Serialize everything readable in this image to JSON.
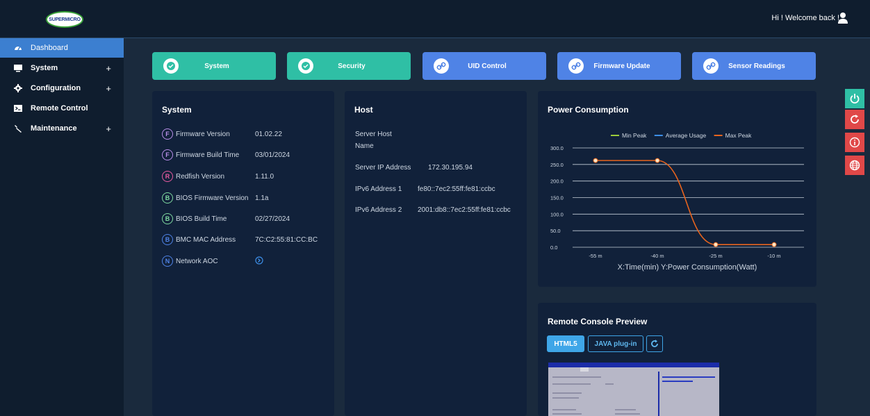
{
  "header": {
    "logo_text": "SUPERMICRO",
    "welcome": "Hi ! Welcome back !"
  },
  "sidebar": {
    "items": [
      {
        "label": "Dashboard",
        "icon": "dashboard-icon",
        "expandable": false,
        "active": true
      },
      {
        "label": "System",
        "icon": "monitor-icon",
        "expandable": true
      },
      {
        "label": "Configuration",
        "icon": "gear-icon",
        "expandable": true
      },
      {
        "label": "Remote Control",
        "icon": "terminal-icon",
        "expandable": false
      },
      {
        "label": "Maintenance",
        "icon": "wrench-icon",
        "expandable": true
      }
    ],
    "plus": "+"
  },
  "quick": [
    {
      "label": "System",
      "color": "#2fbfa5",
      "icon": "status-ok-icon"
    },
    {
      "label": "Security",
      "color": "#2fbfa5",
      "icon": "status-ok-icon"
    },
    {
      "label": "UID Control",
      "color": "#4f83e6",
      "icon": "link-icon"
    },
    {
      "label": "Firmware Update",
      "color": "#4f83e6",
      "icon": "link-icon"
    },
    {
      "label": "Sensor Readings",
      "color": "#4f83e6",
      "icon": "link-icon"
    }
  ],
  "system": {
    "title": "System",
    "rows": [
      {
        "badge": "F",
        "color": "#b98ee8",
        "label": "Firmware Version",
        "value": "01.02.22"
      },
      {
        "badge": "F",
        "color": "#b98ee8",
        "label": "Firmware Build Time",
        "value": "03/01/2024"
      },
      {
        "badge": "R",
        "color": "#e85aa0",
        "label": "Redfish Version",
        "value": "1.11.0"
      },
      {
        "badge": "B",
        "color": "#7fd9a0",
        "label": "BIOS Firmware Version",
        "value": "1.1a"
      },
      {
        "badge": "B",
        "color": "#7fd9a0",
        "label": "BIOS Build Time",
        "value": "02/27/2024"
      },
      {
        "badge": "B",
        "color": "#4f83e6",
        "label": "BMC MAC Address",
        "value": "7C:C2:55:81:CC:BC"
      },
      {
        "badge": "N",
        "color": "#4f83e6",
        "label": "Network AOC",
        "value": ""
      }
    ]
  },
  "host": {
    "title": "Host",
    "server_host_line1": "Server Host",
    "server_host_line2": "Name",
    "ip_label": "Server IP Address",
    "ip_value": "172.30.195.94",
    "ipv6_1_label": "IPv6 Address 1",
    "ipv6_1_value": "fe80::7ec2:55ff:fe81:ccbc",
    "ipv6_2_label": "IPv6 Address 2",
    "ipv6_2_value": "2001:db8::7ec2:55ff:fe81:ccbc"
  },
  "chart_data": {
    "type": "line",
    "title": "Power Consumption",
    "categories": [
      "-55 m",
      "-40 m",
      "-25 m",
      "-10 m"
    ],
    "series": [
      {
        "name": "Min Peak",
        "color": "#9ccc3a",
        "values": []
      },
      {
        "name": "Average Usage",
        "color": "#3c8ee8",
        "values": []
      },
      {
        "name": "Max Peak",
        "color": "#e8641e",
        "values": [
          262,
          262,
          8,
          8
        ]
      }
    ],
    "yticks": [
      "300.0",
      "250.0",
      "200.0",
      "150.0",
      "100.0",
      "50.0",
      "0.0"
    ],
    "ylim": [
      0,
      300
    ],
    "xlabel": "X:Time(min) Y:Power Consumption(Watt)",
    "grid": true,
    "legend": "top"
  },
  "console": {
    "title": "Remote Console Preview",
    "html5": "HTML5",
    "java": "JAVA plug-in"
  }
}
